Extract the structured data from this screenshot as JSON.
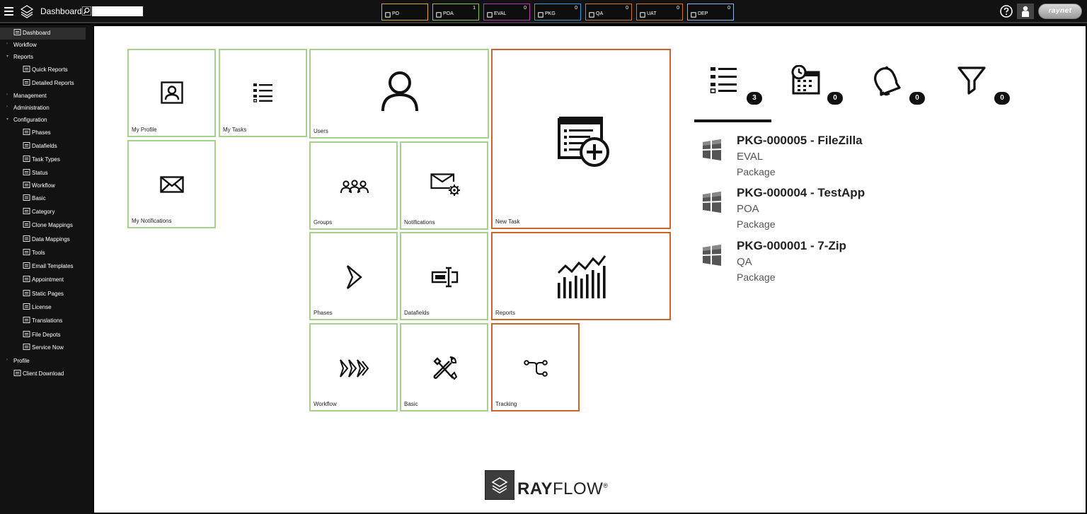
{
  "header": {
    "title": "Dashboard",
    "search_placeholder": "",
    "brand": "raynet"
  },
  "stages": [
    {
      "label": "PO",
      "count": "",
      "color": "#d4a73a",
      "icon": "doc-icon"
    },
    {
      "label": "POA",
      "count": "1",
      "color": "#8fbf5a",
      "icon": "doc-icon"
    },
    {
      "label": "EVAL",
      "count": "0",
      "color": "#b43bb0",
      "icon": "flask-icon"
    },
    {
      "label": "PKG",
      "count": "0",
      "color": "#3a9ad8",
      "icon": "package-icon"
    },
    {
      "label": "QA",
      "count": "0",
      "color": "#d4742a",
      "icon": "search-icon"
    },
    {
      "label": "UAT",
      "count": "0",
      "color": "#d4742a",
      "icon": "checklist-icon"
    },
    {
      "label": "DEP",
      "count": "0",
      "color": "#8ab4e8",
      "icon": "plus-icon"
    }
  ],
  "sidebar": {
    "items": [
      {
        "label": "Dashboard",
        "icon": "dashboard-icon",
        "active": true
      },
      {
        "label": "Workflow"
      },
      {
        "label": "Reports"
      },
      {
        "label": "Quick Reports",
        "icon": "pie-chart-icon"
      },
      {
        "label": "Detailed Reports",
        "icon": "report-icon"
      },
      {
        "label": "Management"
      },
      {
        "label": "Administration"
      },
      {
        "label": "Configuration"
      },
      {
        "label": "Phases",
        "icon": "chevron-icon"
      },
      {
        "label": "Datafields",
        "icon": "datafield-icon"
      },
      {
        "label": "Task Types",
        "icon": "task-types-icon"
      },
      {
        "label": "Status",
        "icon": "status-icon"
      },
      {
        "label": "Workflow",
        "icon": "workflow-icon"
      },
      {
        "label": "Basic",
        "icon": "tools-icon"
      },
      {
        "label": "Category",
        "icon": "category-icon"
      },
      {
        "label": "Clone Mappings",
        "icon": "clone-icon"
      },
      {
        "label": "Data Mappings",
        "icon": "mapping-icon"
      },
      {
        "label": "Tools",
        "icon": "tools-icon"
      },
      {
        "label": "Email Templates",
        "icon": "email-template-icon"
      },
      {
        "label": "Appointment",
        "icon": "calendar-icon"
      },
      {
        "label": "Static Pages",
        "icon": "pages-icon"
      },
      {
        "label": "License",
        "icon": "key-icon"
      },
      {
        "label": "Translations",
        "icon": "translate-icon"
      },
      {
        "label": "File Depots",
        "icon": "file-depot-icon"
      },
      {
        "label": "Service Now",
        "icon": "power-icon"
      },
      {
        "label": "Profile"
      },
      {
        "label": "Client Download",
        "icon": "download-icon"
      }
    ]
  },
  "tiles": {
    "my_profile": "My Profile",
    "my_tasks": "My Tasks",
    "users": "Users",
    "new_task": "New Task",
    "my_notifications": "My Notifications",
    "groups": "Groups",
    "notifications": "Notifications",
    "phases": "Phases",
    "datafields": "Datafields",
    "reports": "Reports",
    "workflow": "Workflow",
    "basic": "Basic",
    "tracking": "Tracking"
  },
  "filters": [
    {
      "icon": "task-list-icon",
      "count": "3"
    },
    {
      "icon": "calendar-clock-icon",
      "count": "0"
    },
    {
      "icon": "bell-icon",
      "count": "0"
    },
    {
      "icon": "filter-icon",
      "count": "0"
    }
  ],
  "tasks": [
    {
      "title": "PKG-000005 - FileZilla",
      "stage": "EVAL",
      "type": "Package"
    },
    {
      "title": "PKG-000004 - TestApp",
      "stage": "POA",
      "type": "Package"
    },
    {
      "title": "PKG-000001 - 7-Zip",
      "stage": "QA",
      "type": "Package"
    }
  ],
  "footer": {
    "brand_bold": "RAY",
    "brand_rest": "FLOW",
    "mark": "®"
  }
}
